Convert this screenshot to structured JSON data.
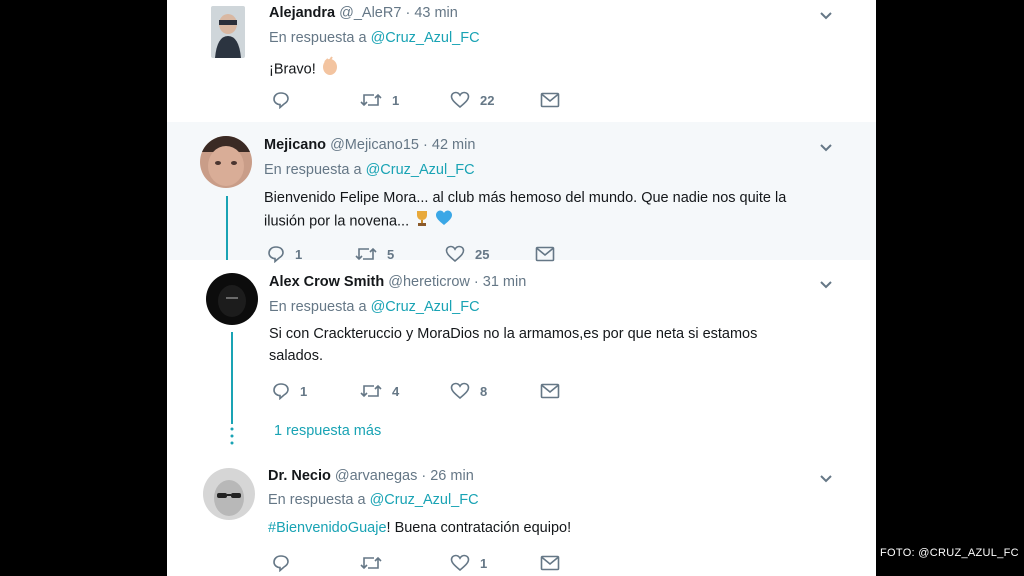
{
  "tweets": [
    {
      "name": "Alejandra",
      "handle": "@_AleR7",
      "time": "43 min",
      "reply_prefix": "En respuesta a",
      "mention": "@Cruz_Azul_FC",
      "text": "¡Bravo!",
      "retweets": "1",
      "likes": "22",
      "replies": ""
    },
    {
      "name": "Mejicano",
      "handle": "@Mejicano15",
      "time": "42 min",
      "reply_prefix": "En respuesta a",
      "mention": "@Cruz_Azul_FC",
      "text_line1": "Bienvenido Felipe Mora... al club más hemoso del mundo. Que nadie nos quite la",
      "text_line2": "ilusión por la novena...",
      "replies": "1",
      "retweets": "5",
      "likes": "25"
    },
    {
      "name": "Alex Crow Smith",
      "handle": "@hereticrow",
      "time": "31 min",
      "reply_prefix": "En respuesta a",
      "mention": "@Cruz_Azul_FC",
      "text_line1": "Si con Crackteruccio y MoraDios no la armamos,es por que neta si estamos",
      "text_line2": "salados.",
      "replies": "1",
      "retweets": "4",
      "likes": "8",
      "more_replies": "1 respuesta más"
    },
    {
      "name": "Dr. Necio",
      "handle": "@arvanegas",
      "time": "26 min",
      "reply_prefix": "En respuesta a",
      "mention": "@Cruz_Azul_FC",
      "hashtag": "#BienvenidoGuaje",
      "text": "! Buena contratación equipo!",
      "likes": "1"
    }
  ],
  "credit": "FOTO: @CRUZ_AZUL_FC",
  "colors": {
    "accent": "#19a3b4",
    "muted": "#657786",
    "highlight_bg": "#f5f8fa"
  }
}
